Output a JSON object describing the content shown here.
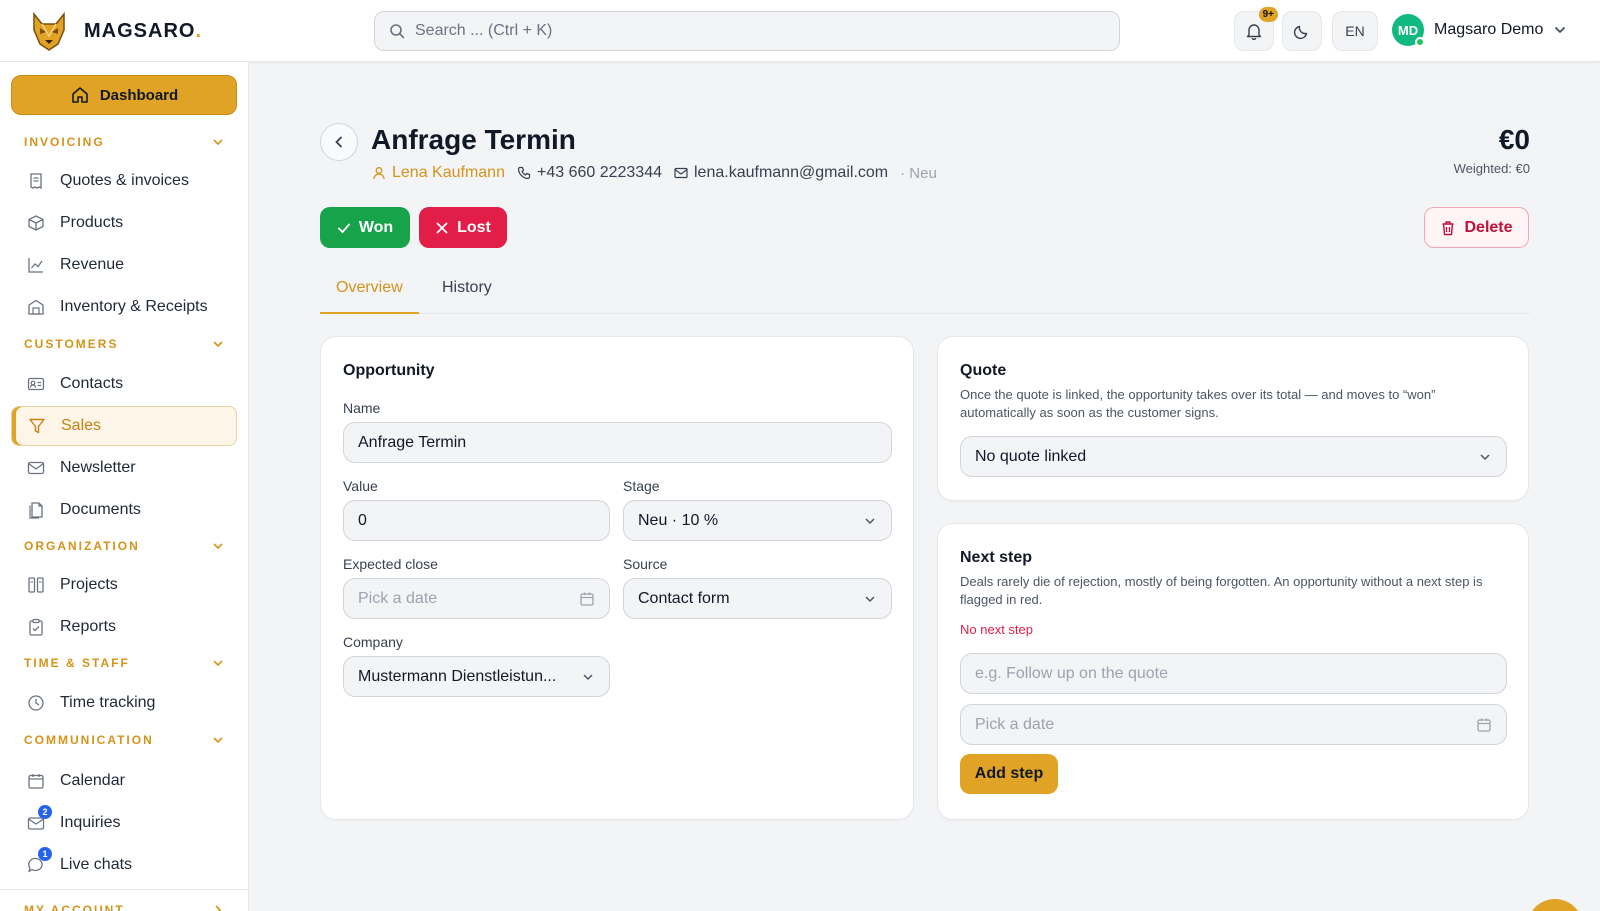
{
  "header": {
    "brand": "MAGSARO",
    "brand_dot": ".",
    "search_placeholder": "Search ... (Ctrl + K)",
    "notification_badge": "9+",
    "language": "EN",
    "user_initials": "MD",
    "user_name": "Magsaro Demo"
  },
  "sidebar": {
    "dashboard": "Dashboard",
    "sections": {
      "invoicing": "INVOICING",
      "customers": "CUSTOMERS",
      "organization": "ORGANIZATION",
      "time_staff": "TIME & STAFF",
      "communication": "COMMUNICATION",
      "my_account": "MY ACCOUNT"
    },
    "items": {
      "quotes": "Quotes & invoices",
      "products": "Products",
      "revenue": "Revenue",
      "inventory": "Inventory & Receipts",
      "contacts": "Contacts",
      "sales": "Sales",
      "newsletter": "Newsletter",
      "documents": "Documents",
      "projects": "Projects",
      "reports": "Reports",
      "time_tracking": "Time tracking",
      "calendar": "Calendar",
      "inquiries": "Inquiries",
      "live_chats": "Live chats"
    },
    "badges": {
      "inquiries": "2",
      "live_chats": "1"
    }
  },
  "page": {
    "title": "Anfrage Termin",
    "contact_name": "Lena Kaufmann",
    "phone": "+43 660 2223344",
    "email": "lena.kaufmann@gmail.com",
    "status": "· Neu",
    "amount": "€0",
    "weighted": "Weighted: €0",
    "won_label": "Won",
    "lost_label": "Lost",
    "delete_label": "Delete",
    "tabs": {
      "overview": "Overview",
      "history": "History"
    }
  },
  "opportunity": {
    "title": "Opportunity",
    "name_label": "Name",
    "name_value": "Anfrage Termin",
    "value_label": "Value",
    "value_value": "0",
    "stage_label": "Stage",
    "stage_value": "Neu · 10 %",
    "expected_close_label": "Expected close",
    "expected_close_placeholder": "Pick a date",
    "source_label": "Source",
    "source_value": "Contact form",
    "company_label": "Company",
    "company_value": "Mustermann Dienstleistun..."
  },
  "quote": {
    "title": "Quote",
    "description": "Once the quote is linked, the opportunity takes over its total — and moves to “won” automatically as soon as the customer signs.",
    "select_value": "No quote linked"
  },
  "next_step": {
    "title": "Next step",
    "description": "Deals rarely die of rejection, mostly of being forgotten. An opportunity without a next step is flagged in red.",
    "warning": "No next step",
    "step_placeholder": "e.g. Follow up on the quote",
    "date_placeholder": "Pick a date",
    "add_label": "Add step"
  },
  "colors": {
    "accent": "#e0a326",
    "won": "#16a34a",
    "lost": "#e11d48",
    "avatar": "#10b981",
    "badge_blue": "#2563eb"
  }
}
